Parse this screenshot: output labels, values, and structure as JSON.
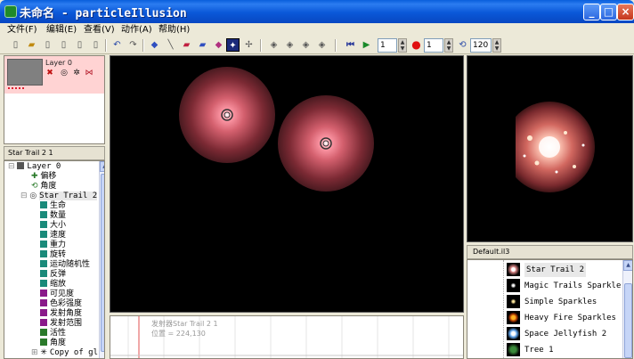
{
  "window": {
    "title": "未命名 - particleIllusion",
    "buttons": {
      "minimize": "_",
      "maximize": "□",
      "close": "×"
    }
  },
  "menu": [
    {
      "label": "文件(F)"
    },
    {
      "label": "编辑(E)"
    },
    {
      "label": "查看(V)"
    },
    {
      "label": "动作(A)"
    },
    {
      "label": "帮助(H)"
    }
  ],
  "toolbar": {
    "frame_value": "1",
    "record_value": "1",
    "loop_value": "120"
  },
  "layer_panel": {
    "layer_name": "Layer 0"
  },
  "tree": {
    "header": "Star Trail 2 1",
    "items": [
      {
        "label": "Layer 0",
        "color": "#555555"
      },
      {
        "label": "偏移",
        "color": "#2a7a2a"
      },
      {
        "label": "角度",
        "color": "#2a7a2a"
      },
      {
        "label": "Star Trail 2",
        "color": "#555555"
      },
      {
        "label": "生命",
        "color": "#1a8a7a"
      },
      {
        "label": "数量",
        "color": "#1a8a7a"
      },
      {
        "label": "大小",
        "color": "#1a8a7a"
      },
      {
        "label": "速度",
        "color": "#1a8a7a"
      },
      {
        "label": "重力",
        "color": "#1a8a7a"
      },
      {
        "label": "旋转",
        "color": "#1a8a7a"
      },
      {
        "label": "运动随机性",
        "color": "#1a8a7a"
      },
      {
        "label": "反弹",
        "color": "#1a8a7a"
      },
      {
        "label": "缩放",
        "color": "#1a8a7a"
      },
      {
        "label": "可见度",
        "color": "#8a1a8a"
      },
      {
        "label": "色彩强度",
        "color": "#8a1a8a"
      },
      {
        "label": "发射角度",
        "color": "#8a1a8a"
      },
      {
        "label": "发射范围",
        "color": "#8a1a8a"
      },
      {
        "label": "活性",
        "color": "#2a7a2a"
      },
      {
        "label": "角度",
        "color": "#2a7a2a"
      },
      {
        "label": "Copy of gl",
        "color": "#555555"
      }
    ]
  },
  "timeline": {
    "emitter_label": "发射器Star Trail 2 1",
    "position_label": "位置 = 224,130"
  },
  "library": {
    "header": "Default.il3",
    "items": [
      {
        "label": "Star Trail 2"
      },
      {
        "label": "Magic Trails Sparkle"
      },
      {
        "label": "Simple Sparkles"
      },
      {
        "label": "Heavy Fire Sparkles"
      },
      {
        "label": "Space Jellyfish 2"
      },
      {
        "label": "Tree 1"
      }
    ]
  },
  "colors": {
    "titlebar": "#0a58d8",
    "layer_selected": "#ffd3d3",
    "emitter_glow": "#c8707a"
  }
}
